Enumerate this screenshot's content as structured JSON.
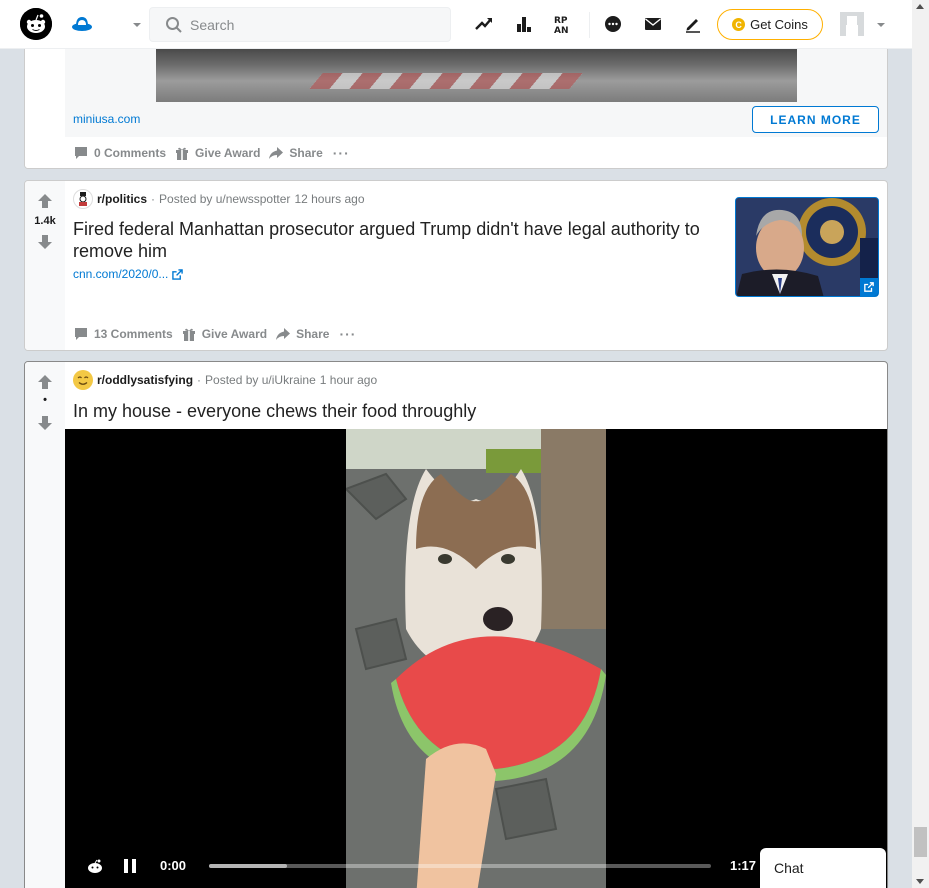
{
  "header": {
    "search_placeholder": "Search",
    "get_coins_label": "Get Coins",
    "coin_symbol": "C",
    "icons": [
      "reddit-logo-icon",
      "home-icon",
      "trending-icon",
      "leaderboard-icon",
      "rpan-icon",
      "chat-icon",
      "mail-icon",
      "create-post-icon"
    ]
  },
  "ad": {
    "domain": "miniusa.com",
    "cta_label": "LEARN MORE",
    "actions": {
      "comments": "0 Comments",
      "award": "Give Award",
      "share": "Share",
      "more": "···"
    }
  },
  "posts": [
    {
      "subreddit": "r/politics",
      "posted_by": "Posted by u/newsspotter",
      "time": "12 hours ago",
      "score": "1.4k",
      "title": "Fired federal Manhattan prosecutor argued Trump didn't have legal authority to remove him",
      "link": "cnn.com/2020/0...",
      "actions": {
        "comments": "13 Comments",
        "award": "Give Award",
        "share": "Share",
        "more": "···"
      }
    },
    {
      "subreddit": "r/oddlysatisfying",
      "posted_by": "Posted by u/iUkraine",
      "time": "1 hour ago",
      "score": "•",
      "title": "In my house - everyone chews their food throughly",
      "video": {
        "current_time": "0:00",
        "duration": "1:17",
        "progress_buffered_fraction": 0.155
      }
    }
  ],
  "meta_separator": "·",
  "chat_label": "Chat",
  "colors": {
    "brand_blue": "#0079d3",
    "coin_border": "#ffb000",
    "page_bg": "#dae0e6"
  }
}
